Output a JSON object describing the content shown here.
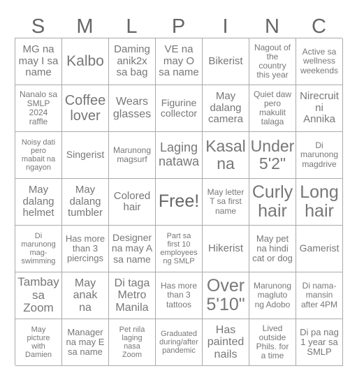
{
  "header": [
    "S",
    "M",
    "L",
    "P",
    "I",
    "N",
    "C"
  ],
  "cells": [
    "MG na\nmay I sa\nname",
    "Kalbo",
    "Daming\nanik2x\nsa bag",
    "VE na\nmay O\nsa name",
    "Bikerist",
    "Nagout of\nthe\ncountry\nthis year",
    "Active sa\nwellness\nweekends",
    "Nanalo sa\nSMLP\n2024\nraffle",
    "Coffee\nlover",
    "Wears\nglasses",
    "Figurine\ncollector",
    "May\ndalang\ncamera",
    "Quiet daw\npero\nmakulit\ntalaga",
    "Nirecruit\nni\nAnnika",
    "Noisy dati\npero\nmabait na\nngayon",
    "Singerist",
    "Marunong\nmagsurf",
    "Laging\nnatawa",
    "Kasal\nna",
    "Under\n5'2\"",
    "Di\nmarunong\nmagdrive",
    "May\ndalang\nhelmet",
    "May\ndalang\ntumbler",
    "Colored\nhair",
    "Free!",
    "May letter\nT sa first\nname",
    "Curly\nhair",
    "Long\nhair",
    "Di\nmarunong\nmag-\nswimming",
    "Has more\nthan 3\npiercings",
    "Designer\nna may A\nsa name",
    "Part sa\nfirst 10\nemployees\nng SMLP",
    "Hikerist",
    "May pet\nna hindi\ncat or dog",
    "Gamerist",
    "Tambay\nsa\nZoom",
    "May\nanak\nna",
    "Di taga\nMetro\nManila",
    "Has more\nthan 3\ntattoos",
    "Over\n5'10\"",
    "Marunong\nmagluto\nng Adobo",
    "Di nama-\nmansin\nafter 4PM",
    "May\npicture\nwith\nDamien",
    "Manager\nna may E\nsa name",
    "Pet nila\nlaging\nnasa\nZoom",
    "Graduated\nduring/after\npandemic",
    "Has\npainted\nnails",
    "Lived\noutside\nPhils. for\na time",
    "Di pa nag\n1 year sa\nSMLP"
  ]
}
